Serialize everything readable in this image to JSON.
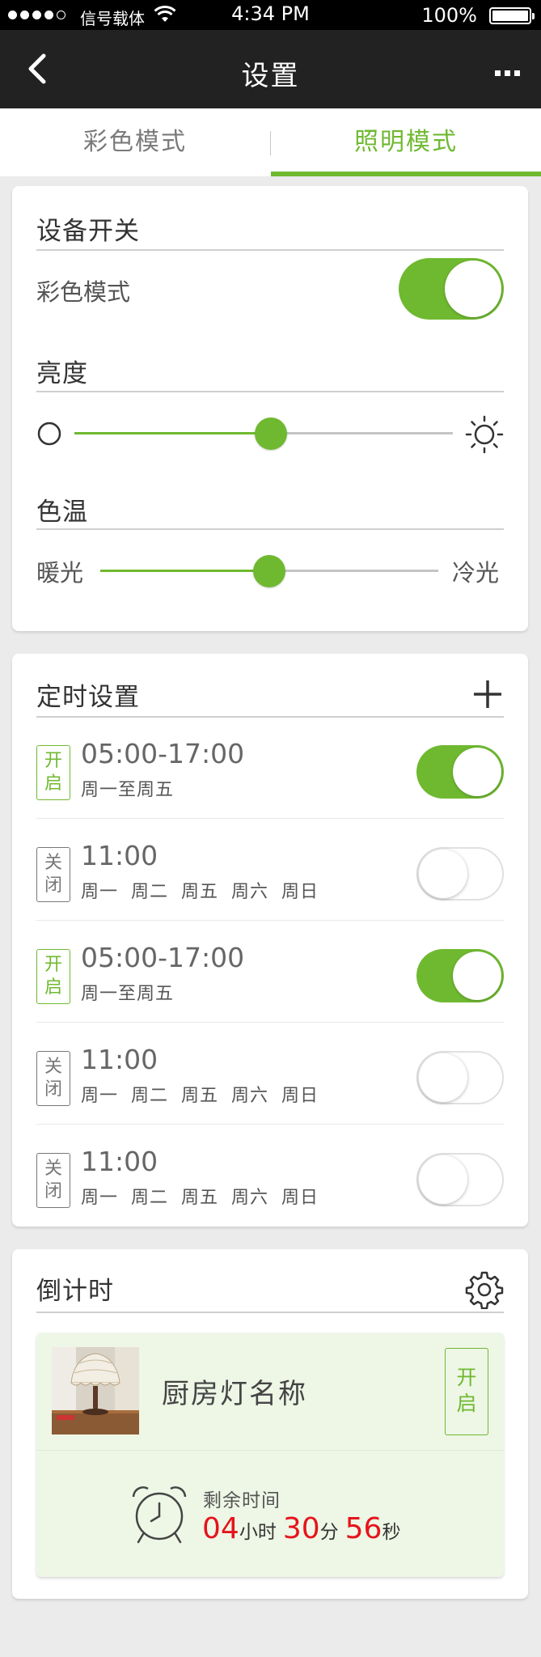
{
  "status_bar": {
    "carrier": "信号载体",
    "time": "4:34 PM",
    "battery": "100%"
  },
  "nav": {
    "title": "设置"
  },
  "tabs": [
    {
      "label": "彩色模式",
      "active": false
    },
    {
      "label": "照明模式",
      "active": true
    }
  ],
  "device": {
    "section_title": "设备开关",
    "switch_label": "彩色模式",
    "switch_on": true,
    "brightness_title": "亮度",
    "brightness_value": 0.52,
    "color_temp_title": "色温",
    "color_temp_left": "暖光",
    "color_temp_right": "冷光",
    "color_temp_value": 0.5
  },
  "timers": {
    "section_title": "定时设置",
    "items": [
      {
        "badge": "开启",
        "time": "05:00-17:00",
        "days": "周一至周五",
        "enabled": true
      },
      {
        "badge": "关闭",
        "time": "11:00",
        "days": "周一 周二 周五 周六 周日",
        "enabled": false
      },
      {
        "badge": "开启",
        "time": "05:00-17:00",
        "days": "周一至周五",
        "enabled": true
      },
      {
        "badge": "关闭",
        "time": "11:00",
        "days": "周一 周二 周五 周六 周日",
        "enabled": false
      },
      {
        "badge": "关闭",
        "time": "11:00",
        "days": "周一 周二 周五 周六 周日",
        "enabled": false
      }
    ]
  },
  "countdown": {
    "section_title": "倒计时",
    "device_name": "厨房灯名称",
    "badge": "开启",
    "remaining_label": "剩余时间",
    "hours": "04",
    "hours_unit": "小时",
    "minutes": "30",
    "minutes_unit": "分",
    "seconds": "56",
    "seconds_unit": "秒"
  },
  "colors": {
    "accent": "#6fb930",
    "countdown_digits": "#e5141b",
    "navbar": "#222222"
  }
}
